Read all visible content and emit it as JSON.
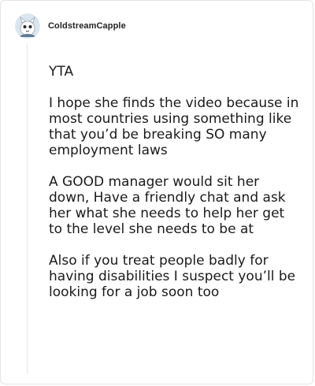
{
  "comment": {
    "username": "ColdstreamCapple",
    "avatar_icon": "avatar-icon",
    "paragraphs": [
      "YTA",
      "I hope she finds the video because in most countries using something like that you’d be breaking SO many employment laws",
      "A GOOD manager would sit her down, Have a friendly chat and ask her what she needs to help her get to the level she needs to be at",
      "Also if you treat people badly for having disabilities I suspect you’ll be looking for a job soon too"
    ]
  }
}
